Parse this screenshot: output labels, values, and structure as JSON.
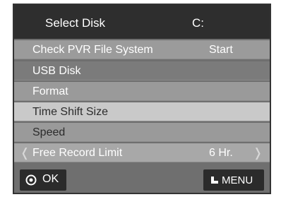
{
  "header": {
    "label": "Select Disk",
    "value": "C:"
  },
  "menu_items": [
    {
      "label": "Check PVR File System",
      "value": "Start"
    },
    {
      "label": "USB Disk",
      "value": ""
    },
    {
      "label": "Format",
      "value": ""
    },
    {
      "label": "Time Shift Size",
      "value": ""
    },
    {
      "label": "Speed",
      "value": ""
    },
    {
      "label": "Free Record Limit",
      "value": "6 Hr."
    }
  ],
  "arrows": {
    "left": "❬",
    "right": "❭"
  },
  "footer": {
    "ok_label": "OK",
    "menu_label": "MENU"
  },
  "icons": {
    "ok": "ok-circle-icon",
    "menu": "return-arrow-icon"
  },
  "colors": {
    "header_bg": "#2e2e2e",
    "panel_bg": "#6f6f6f",
    "highlight_row": "#c9c9c9"
  }
}
